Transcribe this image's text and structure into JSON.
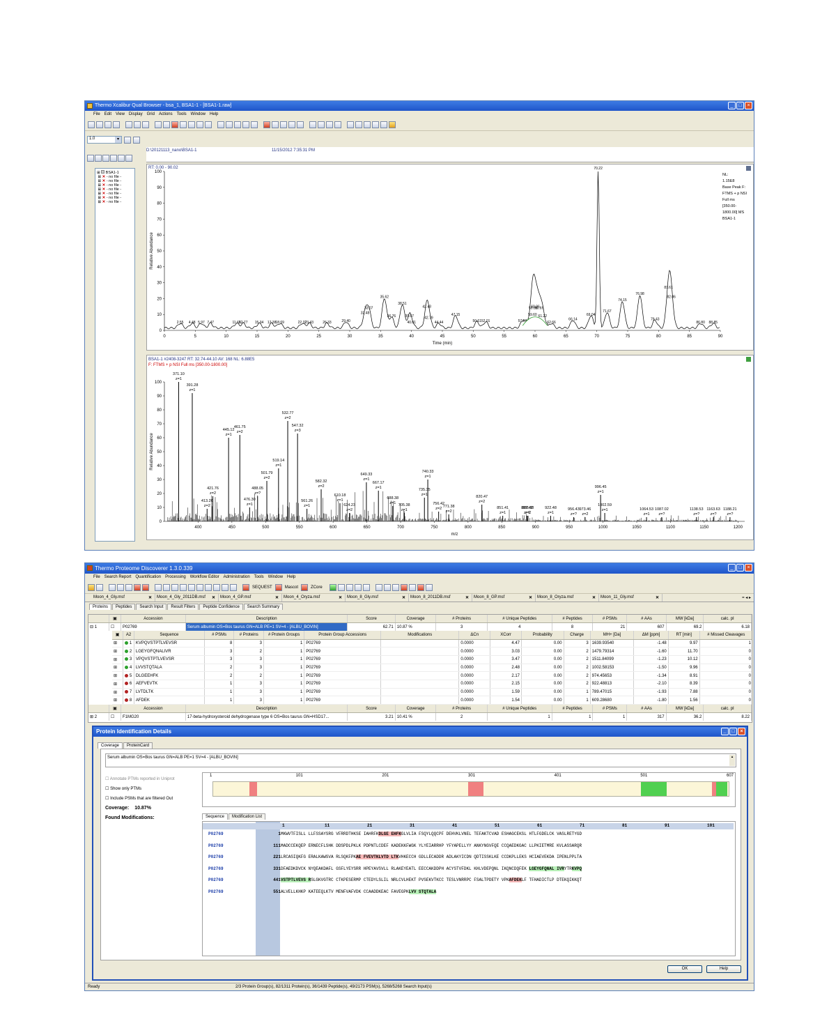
{
  "xcal": {
    "title": "Thermo Xcalibur Qual Browser - bsa_1, BSA1-1 - [BSA1-1.raw]",
    "menu": [
      "File",
      "Edit",
      "View",
      "Display",
      "Grid",
      "Actions",
      "Tools",
      "Window",
      "Help"
    ],
    "zoom_value": "1.0",
    "file_path": "D:\\20121113_nano\\BSA1-1",
    "file_date": "11/15/2012 7:35:31 PM",
    "tree_root": "BSA1-1",
    "tree_items": [
      "- no file -",
      "- no file -",
      "- no file -",
      "- no file -",
      "- no file -",
      "- no file -",
      "- no file -"
    ],
    "chrom": {
      "rt_label": "RT: 0.00 - 90.02",
      "nl_text": [
        "NL:",
        "1.15E8",
        "Base Peak F:",
        "FTMS + p NSI",
        "Full ms",
        "[350.00-",
        "1800.00]  MS",
        "BSA1-1"
      ],
      "ylabel": "Relative Abundance",
      "xlabel": "Time (min)",
      "yticks": [
        0,
        10,
        20,
        30,
        40,
        50,
        60,
        70,
        80,
        90,
        100
      ],
      "xticks": [
        0,
        5,
        10,
        15,
        20,
        25,
        30,
        35,
        40,
        45,
        50,
        55,
        60,
        65,
        70,
        75,
        80,
        85,
        90
      ],
      "peak_labels": [
        {
          "x": 2.55,
          "y": 3,
          "t": "2.55"
        },
        {
          "x": 4.48,
          "y": 3,
          "t": "4.48"
        },
        {
          "x": 5.97,
          "y": 3,
          "t": "5.97"
        },
        {
          "x": 7.47,
          "y": 3,
          "t": "7.47"
        },
        {
          "x": 11.68,
          "y": 3,
          "t": "11.68"
        },
        {
          "x": 12.77,
          "y": 3,
          "t": "12.77"
        },
        {
          "x": 15.34,
          "y": 3,
          "t": "15.34"
        },
        {
          "x": 17.38,
          "y": 3,
          "t": "17.38"
        },
        {
          "x": 18.69,
          "y": 3,
          "t": "18.69"
        },
        {
          "x": 22.32,
          "y": 3,
          "t": "22.32"
        },
        {
          "x": 23.43,
          "y": 3,
          "t": "23.43"
        },
        {
          "x": 26.33,
          "y": 3,
          "t": "26.33"
        },
        {
          "x": 29.4,
          "y": 4,
          "t": "29.40"
        },
        {
          "x": 32.48,
          "y": 9,
          "t": "32.48"
        },
        {
          "x": 33.07,
          "y": 12,
          "t": "33.07"
        },
        {
          "x": 35.62,
          "y": 19,
          "t": "35.62"
        },
        {
          "x": 36.76,
          "y": 7,
          "t": "36.76"
        },
        {
          "x": 38.51,
          "y": 15,
          "t": "38.51"
        },
        {
          "x": 39.67,
          "y": 7,
          "t": "39.67"
        },
        {
          "x": 40.01,
          "y": 3,
          "t": "40.01"
        },
        {
          "x": 42.48,
          "y": 13,
          "t": "42.48"
        },
        {
          "x": 42.79,
          "y": 6,
          "t": "42.79"
        },
        {
          "x": 44.44,
          "y": 3,
          "t": "44.44"
        },
        {
          "x": 47.15,
          "y": 8,
          "t": "47.15"
        },
        {
          "x": 50.61,
          "y": 4,
          "t": "50.61"
        },
        {
          "x": 52.01,
          "y": 4,
          "t": "52.01"
        },
        {
          "x": 57.97,
          "y": 4,
          "t": "57.97"
        },
        {
          "x": 59.69,
          "y": 12,
          "t": "59.69"
        },
        {
          "x": 59.6,
          "y": 8,
          "t": "59.60"
        },
        {
          "x": 61.22,
          "y": 7,
          "t": "61.22"
        },
        {
          "x": 60.06,
          "y": 13,
          "t": "60.06"
        },
        {
          "x": 60.69,
          "y": 12,
          "t": "60.69"
        },
        {
          "x": 62.66,
          "y": 3,
          "t": "62.66"
        },
        {
          "x": 66.14,
          "y": 5,
          "t": "66.14"
        },
        {
          "x": 69.04,
          "y": 8,
          "t": "69.04"
        },
        {
          "x": 70.22,
          "y": 100,
          "t": "70.22"
        },
        {
          "x": 71.67,
          "y": 10,
          "t": "71.67"
        },
        {
          "x": 74.15,
          "y": 17,
          "t": "74.15"
        },
        {
          "x": 76.98,
          "y": 21,
          "t": "76.98"
        },
        {
          "x": 79.43,
          "y": 5,
          "t": "79.43"
        },
        {
          "x": 81.61,
          "y": 25,
          "t": "81.61"
        },
        {
          "x": 82.06,
          "y": 19,
          "t": "82.06"
        },
        {
          "x": 86.8,
          "y": 3,
          "t": "86.80"
        },
        {
          "x": 88.85,
          "y": 3,
          "t": "88.85"
        }
      ]
    },
    "spec": {
      "header1": "BSA1-1 #2408-3247  RT: 32.74-44.10  AV: 168  NL: 6.88E5",
      "header2": "F: FTMS + p NSI Full ms [350.00-1800.00]",
      "ylabel": "Relative Abundance",
      "xlabel": "m/z",
      "yticks": [
        0,
        10,
        20,
        30,
        40,
        50,
        60,
        70,
        80,
        90,
        100
      ],
      "xticks": [
        400,
        450,
        500,
        550,
        600,
        650,
        700,
        750,
        800,
        850,
        900,
        950,
        1000,
        1050,
        1100,
        1150,
        1200
      ],
      "peaks": [
        {
          "mz": 371.1,
          "y": 100,
          "t": "371.10",
          "z": "z=1"
        },
        {
          "mz": 391.28,
          "y": 92,
          "t": "391.28",
          "z": "z=1"
        },
        {
          "mz": 413.26,
          "y": 9,
          "t": "413.26",
          "z": "z=2"
        },
        {
          "mz": 421.76,
          "y": 18,
          "t": "421.76",
          "z": "z=2"
        },
        {
          "mz": 445.12,
          "y": 60,
          "t": "445.12",
          "z": "z=1"
        },
        {
          "mz": 461.75,
          "y": 62,
          "t": "461.75",
          "z": "z=2"
        },
        {
          "mz": 476.3,
          "y": 10,
          "t": "476.30",
          "z": "z=1"
        },
        {
          "mz": 488.05,
          "y": 18,
          "t": "488.05",
          "z": "z=?"
        },
        {
          "mz": 501.79,
          "y": 29,
          "t": "501.79",
          "z": "z=2"
        },
        {
          "mz": 519.14,
          "y": 38,
          "t": "519.14",
          "z": "z=1"
        },
        {
          "mz": 532.77,
          "y": 72,
          "t": "532.77",
          "z": "z=2"
        },
        {
          "mz": 547.32,
          "y": 63,
          "t": "547.32",
          "z": "z=3"
        },
        {
          "mz": 561.26,
          "y": 9,
          "t": "561.26",
          "z": "z=1"
        },
        {
          "mz": 582.32,
          "y": 23,
          "t": "582.32",
          "z": "z=2"
        },
        {
          "mz": 610.18,
          "y": 13,
          "t": "610.18",
          "z": "z=1"
        },
        {
          "mz": 624.23,
          "y": 6,
          "t": "624.23",
          "z": "z=2"
        },
        {
          "mz": 649.33,
          "y": 28,
          "t": "649.33",
          "z": "z=1"
        },
        {
          "mz": 667.17,
          "y": 22,
          "t": "667.17",
          "z": "z=1"
        },
        {
          "mz": 688.38,
          "y": 11,
          "t": "688.38",
          "z": "z=1"
        },
        {
          "mz": 705.38,
          "y": 6,
          "t": "705.38",
          "z": "z=1"
        },
        {
          "mz": 735.35,
          "y": 17,
          "t": "735.35",
          "z": "z=1"
        },
        {
          "mz": 740.33,
          "y": 30,
          "t": "740.33",
          "z": "z=1"
        },
        {
          "mz": 756.42,
          "y": 7,
          "t": "756.42",
          "z": "z=2"
        },
        {
          "mz": 771.38,
          "y": 5,
          "t": "771.38",
          "z": "z=2"
        },
        {
          "mz": 820.47,
          "y": 12,
          "t": "820.47",
          "z": "z=2"
        },
        {
          "mz": 851.41,
          "y": 4,
          "t": "851.41",
          "z": "z=1"
        },
        {
          "mz": 887.42,
          "y": 4,
          "t": "887.42",
          "z": "z=1"
        },
        {
          "mz": 888.88,
          "y": 4,
          "t": "888.88",
          "z": "z=2"
        },
        {
          "mz": 922.48,
          "y": 4,
          "t": "922.48",
          "z": "z=1"
        },
        {
          "mz": 956.43,
          "y": 3,
          "t": "956.43",
          "z": "z=?"
        },
        {
          "mz": 973.46,
          "y": 3,
          "t": "973.46",
          "z": "z=2"
        },
        {
          "mz": 996.45,
          "y": 19,
          "t": "996.45",
          "z": "z=1"
        },
        {
          "mz": 1002.59,
          "y": 6,
          "t": "1002.59",
          "z": "z=1"
        },
        {
          "mz": 1064.53,
          "y": 3,
          "t": "1064.53",
          "z": "z=1"
        },
        {
          "mz": 1087.02,
          "y": 3,
          "t": "1087.02",
          "z": "z=?"
        },
        {
          "mz": 1138.53,
          "y": 3,
          "t": "1138.53",
          "z": "z=?"
        },
        {
          "mz": 1163.63,
          "y": 3,
          "t": "1163.63",
          "z": "z=?"
        },
        {
          "mz": 1188.21,
          "y": 3,
          "t": "1188.21",
          "z": "z=?"
        }
      ]
    }
  },
  "pd": {
    "title": "Thermo Proteome Discoverer 1.3.0.339",
    "menu": [
      "File",
      "Search Report",
      "Quantification",
      "Processing",
      "Workflow Editor",
      "Administration",
      "Tools",
      "Window",
      "Help"
    ],
    "tool_labels": [
      "SEQUEST",
      "Mascot",
      "ZCore"
    ],
    "files": [
      "Moon_4_Gly.msf",
      "Moon_4_Gly_2011DB.msf",
      "Moon_4_GP.msf",
      "Moon_4_Oryza.msf",
      "Moon_8_Gly.msf",
      "Moon_8_2011DB.msf",
      "Moon_8_GP.msf",
      "Moon_8_Oryza.msf",
      "Moon_11_Gly.msf"
    ],
    "tabs": [
      "Proteins",
      "Peptides",
      "Search Input",
      "Result Filters",
      "Peptide Confidence",
      "Search Summary"
    ],
    "prot_headers": [
      "Accession",
      "Description",
      "Score",
      "Coverage",
      "# Proteins",
      "# Unique Peptides",
      "# Peptides",
      "# PSMs",
      "# AAs",
      "MW [kDa]",
      "calc. pI"
    ],
    "prot1": {
      "idx": "1",
      "acc": "P02769",
      "desc": "Serum albumin OS=Bos taurus GN=ALB PE=1 SV=4 - [ALBU_BOVIN]",
      "score": "62.71",
      "cov": "10.87 %",
      "np": "3",
      "nup": "4",
      "npep": "8",
      "npsm": "21",
      "aas": "607",
      "mw": "69.2",
      "pi": "6.18"
    },
    "pep_headers": [
      "A2",
      "Sequence",
      "# PSMs",
      "# Proteins",
      "# Protein Groups",
      "Protein Group Accessions",
      "Modifications",
      "ΔCn",
      "XCorr",
      "Probability",
      "Charge",
      "MH+ [Da]",
      "ΔM [ppm]",
      "RT [min]",
      "# Missed Cleavages"
    ],
    "peptides": [
      {
        "n": "1",
        "c": "#2ca02c",
        "seq": "KVPQVSTPTLVEVSR",
        "psm": "8",
        "prot": "3",
        "pg": "1",
        "acc": "P02769",
        "mod": "",
        "dcn": "0.0000",
        "xc": "4.47",
        "prob": "0.00",
        "ch": "3",
        "mh": "1639.93540",
        "dm": "-1.48",
        "rt": "9.97",
        "mc": "1"
      },
      {
        "n": "2",
        "c": "#2ca02c",
        "seq": "LGEYGFQNALIVR",
        "psm": "3",
        "prot": "2",
        "pg": "1",
        "acc": "P02769",
        "mod": "",
        "dcn": "0.0000",
        "xc": "3.03",
        "prob": "0.00",
        "ch": "2",
        "mh": "1479.79314",
        "dm": "-1.60",
        "rt": "11.70",
        "mc": "0"
      },
      {
        "n": "3",
        "c": "#2ca02c",
        "seq": "VPQVSTPTLVEVSR",
        "psm": "3",
        "prot": "3",
        "pg": "1",
        "acc": "P02769",
        "mod": "",
        "dcn": "0.0000",
        "xc": "3.47",
        "prob": "0.00",
        "ch": "2",
        "mh": "1511.84099",
        "dm": "-1.23",
        "rt": "10.12",
        "mc": "0"
      },
      {
        "n": "4",
        "c": "#2ca02c",
        "seq": "LVVSTQTALA",
        "psm": "2",
        "prot": "3",
        "pg": "1",
        "acc": "P02769",
        "mod": "",
        "dcn": "0.0000",
        "xc": "2.48",
        "prob": "0.00",
        "ch": "2",
        "mh": "1002.58153",
        "dm": "-1.50",
        "rt": "9.96",
        "mc": "0"
      },
      {
        "n": "5",
        "c": "#b22222",
        "seq": "DLGEEHFK",
        "psm": "2",
        "prot": "2",
        "pg": "1",
        "acc": "P02769",
        "mod": "",
        "dcn": "0.0000",
        "xc": "2.17",
        "prob": "0.00",
        "ch": "2",
        "mh": "974.45653",
        "dm": "-1.34",
        "rt": "8.91",
        "mc": "0"
      },
      {
        "n": "6",
        "c": "#b22222",
        "seq": "AEFVEVTK",
        "psm": "1",
        "prot": "3",
        "pg": "1",
        "acc": "P02769",
        "mod": "",
        "dcn": "0.0000",
        "xc": "2.15",
        "prob": "0.00",
        "ch": "2",
        "mh": "922.48813",
        "dm": "-2.10",
        "rt": "8.39",
        "mc": "0"
      },
      {
        "n": "7",
        "c": "#b22222",
        "seq": "LVTDLTK",
        "psm": "1",
        "prot": "3",
        "pg": "1",
        "acc": "P02769",
        "mod": "",
        "dcn": "0.0000",
        "xc": "1.59",
        "prob": "0.00",
        "ch": "1",
        "mh": "789.47015",
        "dm": "-1.93",
        "rt": "7.88",
        "mc": "0"
      },
      {
        "n": "8",
        "c": "#b22222",
        "seq": "AFDEK",
        "psm": "1",
        "prot": "3",
        "pg": "1",
        "acc": "P02769",
        "mod": "",
        "dcn": "0.0000",
        "xc": "1.54",
        "prob": "0.00",
        "ch": "1",
        "mh": "609.28680",
        "dm": "-1.80",
        "rt": "1.56",
        "mc": "0"
      }
    ],
    "prot2": {
      "idx": "2",
      "acc": "F1MG20",
      "desc": "17-beta-hydroxysteroid dehydrogenase type 6 OS=Bos taurus GN=HSD17...",
      "score": "3.21",
      "cov": "10.41 %",
      "np": "2",
      "nup": "1",
      "npep": "1",
      "npsm": "1",
      "aas": "317",
      "mw": "36.2",
      "pi": "8.22"
    },
    "dialog": {
      "title": "Protein Identification Details",
      "tabs": [
        "Coverage",
        "ProteinCard"
      ],
      "desc": "Serum albumin OS=Bos taurus GN=ALB PE=1 SV=4 - [ALBU_BOVIN]",
      "opt1": "Annotate PTMs reported in Uniprot",
      "opt2": "Show only PTMs",
      "opt3": "Include PSMs that are filtered Out",
      "coverage_label": "Coverage:",
      "coverage_value": "10.87%",
      "found_mods": "Found Modifications:",
      "ruler": [
        "1",
        "101",
        "201",
        "301",
        "401",
        "501",
        "607"
      ],
      "cov_regions": [
        [
          0.07,
          0.085
        ],
        [
          0.495,
          0.525
        ],
        [
          0.83,
          0.85
        ],
        [
          0.85,
          0.88
        ],
        [
          0.968,
          0.98
        ],
        [
          0.976,
          0.997
        ]
      ],
      "seq_tabs": [
        "Sequence",
        "Modification List"
      ],
      "seq_cols": [
        "1",
        "11",
        "21",
        "31",
        "41",
        "51",
        "61",
        "71",
        "81",
        "91",
        "101"
      ],
      "seq_rows": [
        {
          "acc": "P02769",
          "start": "1",
          "segs": [
            {
              "t": "MKWVTFISLL LLFSSAYSRG VFRRDTHKSE IAHRFK",
              "h": ""
            },
            {
              "t": "DLGE EHFK",
              "h": "r"
            },
            {
              "t": "GLVLIA FSQYLQQCPF DEHVKLVNEL TEFAKTCVAD ESHAGCEKSL HTLFGDELCK VASLRETYGD",
              "h": ""
            }
          ]
        },
        {
          "acc": "P02769",
          "start": "111",
          "segs": [
            {
              "t": "MADCCEKQEP ERNECFLSHK DDSPDLPKLK PDPNTLCDEF KADEKKFWGK YLYEIARRHP YFYAPELLYY ANKYNGVFQE CCQAEDKGAC LLPKIETMRE KVLASSARQR",
              "h": ""
            }
          ]
        },
        {
          "acc": "P02769",
          "start": "221",
          "segs": [
            {
              "t": "LRCASIQKFG ERALKAWSVA RLSQKFPK",
              "h": ""
            },
            {
              "t": "AE FVEVTKLVTD LTK",
              "h": "r"
            },
            {
              "t": "VHKECCH GDLLECADDR ADLAKYICDN QDTISSKLKE CCDKPLLEKS HCIAEVEKDA IPENLPPLTA",
              "h": ""
            }
          ]
        },
        {
          "acc": "P02769",
          "start": "331",
          "segs": [
            {
              "t": "DFAEDKDVCK NYQEAKDAFL GSFLYEYSRR HPEYAVSVLL RLAKEYEATL EECCAKDDPH ACYSTVFDKL KHLVDEPQNL IKQNCDQFEK ",
              "h": ""
            },
            {
              "t": "LGEYGFQNAL IVR",
              "h": "g"
            },
            {
              "t": "YTR",
              "h": ""
            },
            {
              "t": "KVPQ",
              "h": "g"
            }
          ]
        },
        {
          "acc": "P02769",
          "start": "441",
          "segs": [
            {
              "t": "VSTPTLVEVS R",
              "h": "g"
            },
            {
              "t": "SLGKVGTRC CTKPESERMP CTEDYLSLIL NRLCVLHEKT PVSEKVTKCC TESLVNRRPC FSALTPDETY VPK",
              "h": ""
            },
            {
              "t": "AFDEK",
              "h": "r"
            },
            {
              "t": "LF TFHADICTLP DTEKQIKKQT",
              "h": ""
            }
          ]
        },
        {
          "acc": "P02769",
          "start": "551",
          "segs": [
            {
              "t": "ALVELLKHKP KATEEQLKTV MENFVAFVDK CCAADDKEAC FAVEGPK",
              "h": ""
            },
            {
              "t": "LVV STQTALA",
              "h": "g"
            }
          ]
        }
      ],
      "ok": "OK",
      "help": "Help"
    },
    "status_left": "Ready",
    "status": "2/3 Protein Group(s), 82/1311 Protein(s), 36/1439 Peptide(s), 49/2173 PSM(s), 5268/5268 Search Input(s)"
  }
}
